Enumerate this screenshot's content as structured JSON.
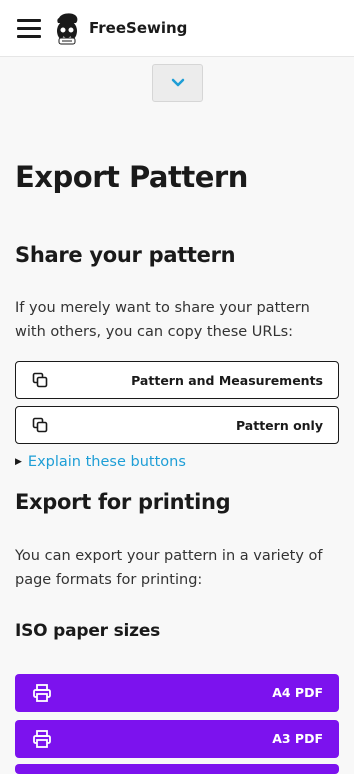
{
  "header": {
    "brand": "FreeSewing",
    "menu_icon": "hamburger-icon",
    "logo_icon": "freesewing-logo"
  },
  "toggle": {
    "icon": "chevron-down-icon",
    "accent": "#1e9ed6"
  },
  "page": {
    "title": "Export Pattern",
    "share": {
      "heading": "Share your pattern",
      "text": "If you merely want to share your pattern with others, you can copy these URLs:",
      "buttons": [
        {
          "label": "Pattern and Measurements",
          "icon": "copy-icon"
        },
        {
          "label": "Pattern only",
          "icon": "copy-icon"
        }
      ],
      "explain": "Explain these buttons"
    },
    "print": {
      "heading": "Export for printing",
      "text": "You can export your pattern in a variety of page formats for printing:",
      "iso_heading": "ISO paper sizes",
      "buttons": [
        {
          "label": "A4 PDF",
          "icon": "printer-icon"
        },
        {
          "label": "A3 PDF",
          "icon": "printer-icon"
        }
      ]
    }
  },
  "colors": {
    "primary": "#7c12ee",
    "link": "#1e9ed6",
    "background": "#f8f8f8",
    "text": "#1a1a1a"
  }
}
